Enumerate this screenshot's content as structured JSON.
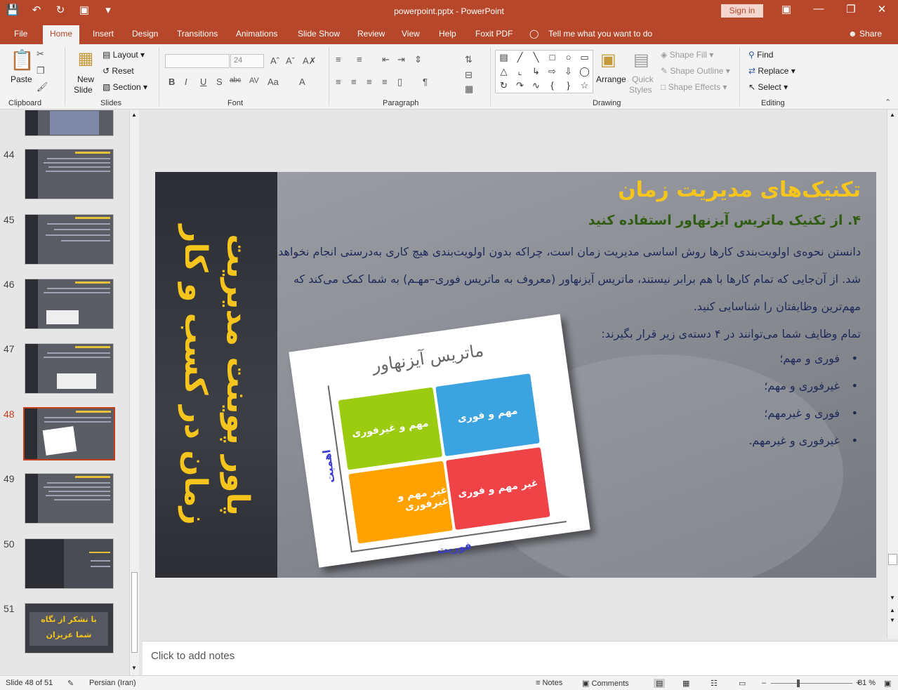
{
  "app": {
    "doc_title": "powerpoint.pptx  -  PowerPoint",
    "sign_in": "Sign in",
    "tell_me": "Tell me what you want to do",
    "share": "Share"
  },
  "tabs": [
    "File",
    "Home",
    "Insert",
    "Design",
    "Transitions",
    "Animations",
    "Slide Show",
    "Review",
    "View",
    "Help",
    "Foxit PDF"
  ],
  "ribbon": {
    "clipboard": {
      "label": "Clipboard",
      "paste": "Paste"
    },
    "slides": {
      "label": "Slides",
      "new_slide_1": "New",
      "new_slide_2": "Slide",
      "layout": "Layout",
      "reset": "Reset",
      "section": "Section"
    },
    "font": {
      "label": "Font",
      "size": "24"
    },
    "paragraph": {
      "label": "Paragraph"
    },
    "drawing": {
      "label": "Drawing",
      "arrange": "Arrange",
      "quick_styles_1": "Quick",
      "quick_styles_2": "Styles",
      "shape_fill": "Shape Fill",
      "shape_outline": "Shape Outline",
      "shape_effects": "Shape Effects"
    },
    "editing": {
      "label": "Editing",
      "find": "Find",
      "replace": "Replace",
      "select": "Select"
    }
  },
  "thumbnails": [
    {
      "num": "44"
    },
    {
      "num": "45"
    },
    {
      "num": "46"
    },
    {
      "num": "47"
    },
    {
      "num": "48"
    },
    {
      "num": "49"
    },
    {
      "num": "50"
    },
    {
      "num": "51"
    }
  ],
  "thumb51_text": "با تشکر از نگاه\nشما عزیزان",
  "slide": {
    "side_title": "پاور پوینت مدیریت زمان در کسب و کار",
    "title": "تکنیک‌های مدیریت زمان",
    "subtitle": "۴. از تکنیک ماتریس آیزنهاور استفاده کنید",
    "paragraph": "دانستن نحوه‌ی اولویت‌بندی کارها روش اساسی مدیریت زمان است، چراکه بدون اولویت‌بندی هیچ کاری به‌درستی انجام نخواهد شد. از آن‌جایی که تمام کارها با هم برابر نیستند، ماتریس آیزنهاور (معروف به ماتریس فوری–مهـم) به شما کمک می‌کند که مهم‌ترین وظایفتان را شناسایی کنید.",
    "intro": "تمام وظایف شما می‌توانند در ۴ دسته‌ی زیر قرار بگیرند:",
    "bullets": [
      "فوری و مهم؛",
      "غیرفوری و مهم؛",
      "فوری و غیرمهم؛",
      "غیرفوری و غیرمهم."
    ],
    "matrix": {
      "title": "ماتریس آیزنهاور",
      "q_urgent_important": "مهم و فوری",
      "q_notUrgent_important": "مهم و غیرفوری",
      "q_urgent_notImportant": "غیر مهم و فوری",
      "q_notUrgent_notImportant": "غیر مهم و غیرفوری",
      "y_axis": "اهمیت",
      "x_axis": "فوریت"
    }
  },
  "notes_placeholder": "Click to add notes",
  "status": {
    "slide_of": "Slide 48 of 51",
    "language": "Persian (Iran)",
    "notes": "Notes",
    "comments": "Comments",
    "zoom": "81 %"
  }
}
